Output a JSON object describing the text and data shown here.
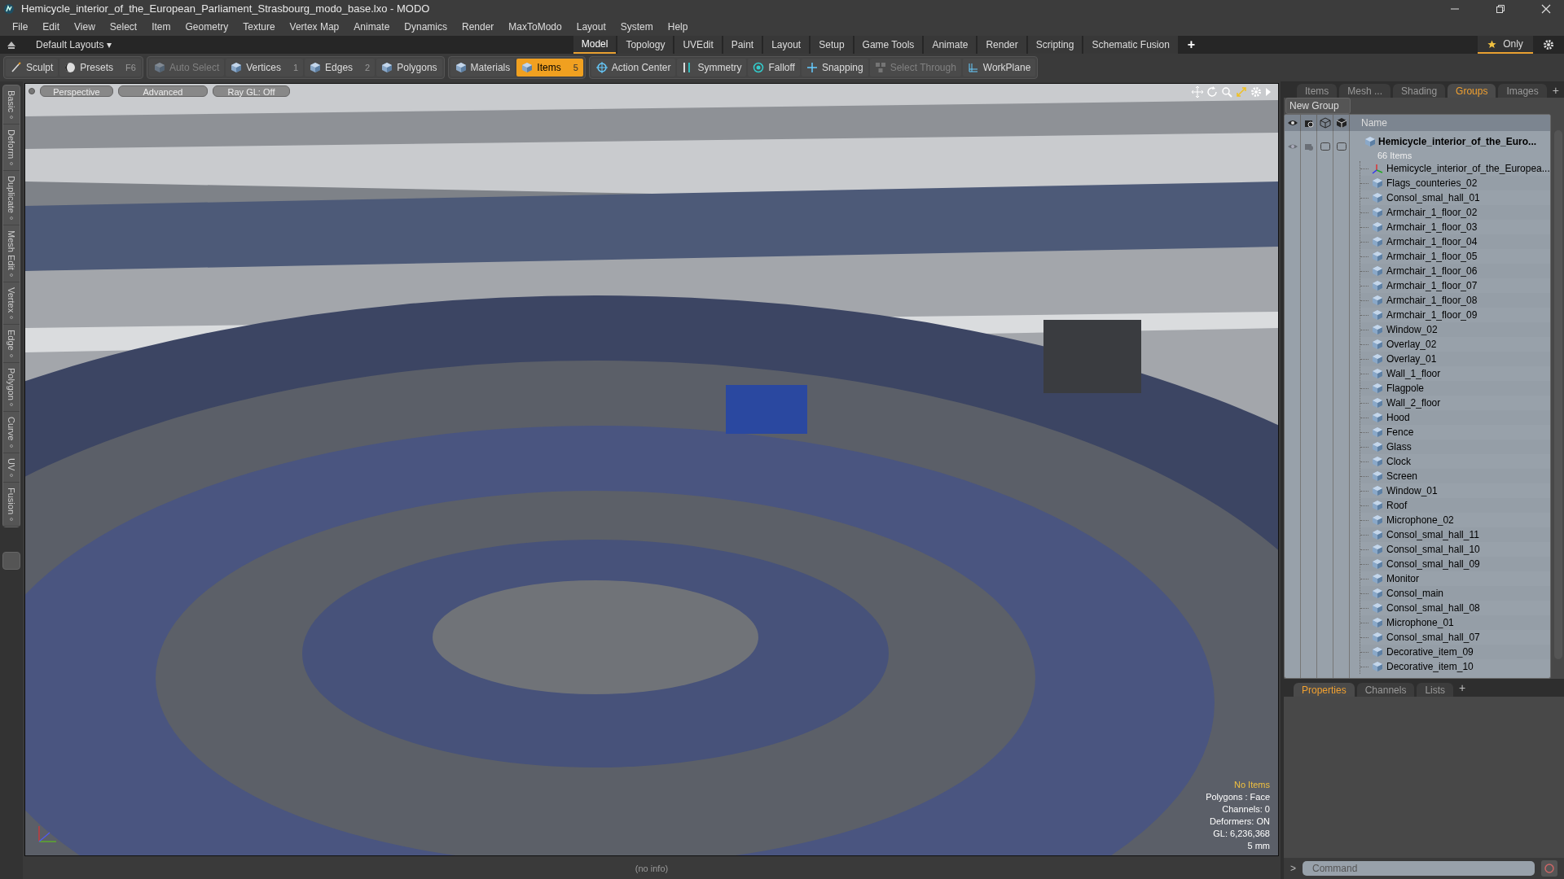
{
  "window": {
    "title": "Hemicycle_interior_of_the_European_Parliament_Strasbourg_modo_base.lxo - MODO"
  },
  "menu": [
    "File",
    "Edit",
    "View",
    "Select",
    "Item",
    "Geometry",
    "Texture",
    "Vertex Map",
    "Animate",
    "Dynamics",
    "Render",
    "MaxToModo",
    "Layout",
    "System",
    "Help"
  ],
  "layout_bar": {
    "layouts": "Default Layouts ▾",
    "tabs": [
      {
        "label": "Model",
        "selected": true
      },
      {
        "label": "Topology",
        "selected": false
      },
      {
        "label": "UVEdit",
        "selected": false
      },
      {
        "label": "Paint",
        "selected": false
      },
      {
        "label": "Layout",
        "selected": false
      },
      {
        "label": "Setup",
        "selected": false
      },
      {
        "label": "Game Tools",
        "selected": false
      },
      {
        "label": "Animate",
        "selected": false
      },
      {
        "label": "Render",
        "selected": false
      },
      {
        "label": "Scripting",
        "selected": false
      },
      {
        "label": "Schematic Fusion",
        "selected": false
      }
    ],
    "add": "+",
    "only": "Only"
  },
  "toolbar": [
    {
      "items": [
        {
          "label": "Sculpt",
          "kind": "brush",
          "selected": false,
          "disabled": false
        },
        {
          "label": "Presets",
          "key": "F6",
          "kind": "ball",
          "selected": false,
          "disabled": false
        }
      ]
    },
    {
      "items": [
        {
          "label": "Auto Select",
          "kind": "cube",
          "selected": false,
          "disabled": true
        },
        {
          "label": "Vertices",
          "key": "1",
          "kind": "cube",
          "selected": false,
          "disabled": false
        },
        {
          "label": "Edges",
          "key": "2",
          "kind": "cube",
          "selected": false,
          "disabled": false
        },
        {
          "label": "Polygons",
          "kind": "cube",
          "selected": false,
          "disabled": false
        }
      ]
    },
    {
      "items": [
        {
          "label": "Materials",
          "kind": "cube",
          "selected": false,
          "disabled": false
        },
        {
          "label": "Items",
          "key": "5",
          "kind": "cube",
          "selected": true,
          "disabled": false
        }
      ]
    },
    {
      "items": [
        {
          "label": "Action Center",
          "kind": "target",
          "selected": false,
          "disabled": false
        },
        {
          "label": "Symmetry",
          "kind": "bar",
          "selected": false,
          "disabled": false
        },
        {
          "label": "Falloff",
          "kind": "ring",
          "selected": false,
          "disabled": false
        },
        {
          "label": "Snapping",
          "kind": "cross",
          "selected": false,
          "disabled": false
        },
        {
          "label": "Select Through",
          "kind": "cubes",
          "selected": false,
          "disabled": true
        },
        {
          "label": "WorkPlane",
          "kind": "grid",
          "selected": false,
          "disabled": false
        }
      ]
    }
  ],
  "left_tabs": [
    "Basic",
    "Deform",
    "Duplicate",
    "Mesh Edit",
    "Vertex",
    "Edge",
    "Polygon",
    "Curve",
    "UV",
    "Fusion"
  ],
  "viewport": {
    "buttons": [
      "Perspective",
      "Advanced",
      "Ray GL: Off"
    ],
    "info": [
      {
        "text": "No Items",
        "kind": "warning"
      },
      {
        "text": "Polygons : Face",
        "kind": "normal"
      },
      {
        "text": "Channels: 0",
        "kind": "normal"
      },
      {
        "text": "Deformers: ON",
        "kind": "normal"
      },
      {
        "text": "GL: 6,236,368",
        "kind": "normal"
      },
      {
        "text": "5 mm",
        "kind": "normal"
      }
    ]
  },
  "status_bar": "(no info)",
  "panel": {
    "tabs": [
      {
        "label": "Items",
        "selected": false
      },
      {
        "label": "Mesh ...",
        "selected": false
      },
      {
        "label": "Shading",
        "selected": false
      },
      {
        "label": "Groups",
        "selected": true
      },
      {
        "label": "Images",
        "selected": false
      }
    ],
    "add": "+",
    "new_group": "New Group",
    "column": "Name",
    "group": {
      "name": "Hemicycle_interior_of_the_Euro...",
      "count": "66 Items",
      "children": [
        {
          "name": "Hemicycle_interior_of_the_Europea...",
          "kind": "locator"
        },
        {
          "name": "Flags_counteries_02",
          "kind": "mesh"
        },
        {
          "name": "Consol_smal_hall_01",
          "kind": "mesh"
        },
        {
          "name": "Armchair_1_floor_02",
          "kind": "mesh"
        },
        {
          "name": "Armchair_1_floor_03",
          "kind": "mesh"
        },
        {
          "name": "Armchair_1_floor_04",
          "kind": "mesh"
        },
        {
          "name": "Armchair_1_floor_05",
          "kind": "mesh"
        },
        {
          "name": "Armchair_1_floor_06",
          "kind": "mesh"
        },
        {
          "name": "Armchair_1_floor_07",
          "kind": "mesh"
        },
        {
          "name": "Armchair_1_floor_08",
          "kind": "mesh"
        },
        {
          "name": "Armchair_1_floor_09",
          "kind": "mesh"
        },
        {
          "name": "Window_02",
          "kind": "mesh"
        },
        {
          "name": "Overlay_02",
          "kind": "mesh"
        },
        {
          "name": "Overlay_01",
          "kind": "mesh"
        },
        {
          "name": "Wall_1_floor",
          "kind": "mesh"
        },
        {
          "name": "Flagpole",
          "kind": "mesh"
        },
        {
          "name": "Wall_2_floor",
          "kind": "mesh"
        },
        {
          "name": "Hood",
          "kind": "mesh"
        },
        {
          "name": "Fence",
          "kind": "mesh"
        },
        {
          "name": "Glass",
          "kind": "mesh"
        },
        {
          "name": "Clock",
          "kind": "mesh"
        },
        {
          "name": "Screen",
          "kind": "mesh"
        },
        {
          "name": "Window_01",
          "kind": "mesh"
        },
        {
          "name": "Roof",
          "kind": "mesh"
        },
        {
          "name": "Microphone_02",
          "kind": "mesh"
        },
        {
          "name": "Consol_smal_hall_11",
          "kind": "mesh"
        },
        {
          "name": "Consol_smal_hall_10",
          "kind": "mesh"
        },
        {
          "name": "Consol_smal_hall_09",
          "kind": "mesh"
        },
        {
          "name": "Monitor",
          "kind": "mesh"
        },
        {
          "name": "Consol_main",
          "kind": "mesh"
        },
        {
          "name": "Consol_smal_hall_08",
          "kind": "mesh"
        },
        {
          "name": "Microphone_01",
          "kind": "mesh"
        },
        {
          "name": "Consol_smal_hall_07",
          "kind": "mesh"
        },
        {
          "name": "Decorative_item_09",
          "kind": "mesh"
        },
        {
          "name": "Decorative_item_10",
          "kind": "mesh"
        }
      ]
    }
  },
  "bottom_tabs": [
    {
      "label": "Properties",
      "selected": true
    },
    {
      "label": "Channels",
      "selected": false
    },
    {
      "label": "Lists",
      "selected": false
    }
  ],
  "bottom_add": "+",
  "command": {
    "prompt": ">",
    "placeholder": "Command"
  }
}
